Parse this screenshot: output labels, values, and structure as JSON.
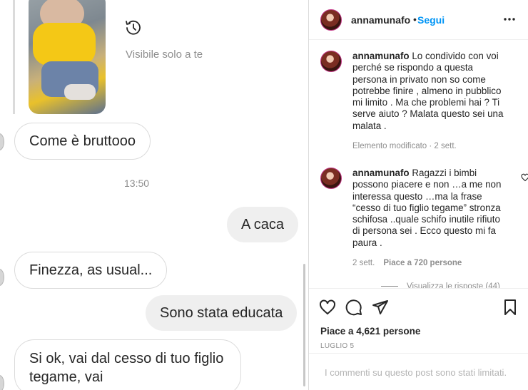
{
  "chat": {
    "visible_note": "Visibile solo a te",
    "timestamp": "13:50",
    "messages": [
      {
        "text": "Come è bruttooo",
        "direction": "in"
      },
      {
        "text": "A caca",
        "direction": "out"
      },
      {
        "text": "Finezza, as usual...",
        "direction": "in"
      },
      {
        "text": "Sono stata educata",
        "direction": "out"
      },
      {
        "text": "Si ok, vai dal cesso di tuo figlio tegame, vai",
        "direction": "in"
      }
    ],
    "icons": {
      "history": "history-icon"
    }
  },
  "post": {
    "username": "annamunafo",
    "separator": "•",
    "follow_label": "Segui",
    "comments": [
      {
        "username": "annamunafo",
        "text": "Lo condivido con voi perché se rispondo a questa persona in privato non so come potrebbe finire , almeno in pubblico mi limito . Ma che problemi hai ? Ti serve aiuto ? Malata questo sei una malata .",
        "meta": "Elemento modificato · 2 sett."
      },
      {
        "username": "annamunafo",
        "text": "Ragazzi i bimbi possono piacere e non …a me non interessa questo …ma la frase “cesso di tuo figlio tegame” stronza schifosa ..quale schifo inutile rifiuto di persona sei . Ecco questo mi fa paura .",
        "meta": "2 sett.",
        "likes": "Piace a 720 persone"
      }
    ],
    "view_replies": "Visualizza le risposte (44)",
    "likes": "Piace a 4,621 persone",
    "date": "LUGLIO 5",
    "comments_limited": "I commenti su questo post sono stati limitati.",
    "colors": {
      "link": "#0095f6",
      "muted": "#8e8e8e",
      "text": "#262626"
    }
  }
}
